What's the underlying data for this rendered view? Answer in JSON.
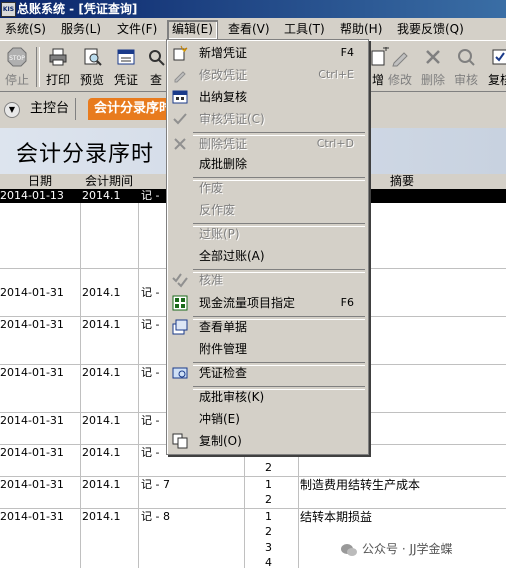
{
  "window": {
    "logo_text": "KIS",
    "title": "总账系统 - [凭证查询]"
  },
  "menubar": [
    {
      "label": "系统(S)"
    },
    {
      "label": "服务(L)"
    },
    {
      "label": "文件(F)"
    },
    {
      "label": "编辑(E)"
    },
    {
      "label": "查看(V)"
    },
    {
      "label": "工具(T)"
    },
    {
      "label": "帮助(H)"
    },
    {
      "label": "我要反馈(Q)"
    }
  ],
  "toolbar": {
    "stop": "停止",
    "print": "打印",
    "preview": "预览",
    "voucher": "凭证",
    "search": "查",
    "add": "增",
    "modify": "修改",
    "delete": "删除",
    "audit": "审核",
    "review": "复核"
  },
  "tabs": {
    "home": "主控台",
    "current": "会计分录序时"
  },
  "page_title": "会计分录序时",
  "grid": {
    "headers": {
      "date": "日期",
      "period": "会计期间",
      "summary": "摘要"
    },
    "rows": [
      {
        "date": "2014-01-13",
        "period": "2014.1",
        "voucher": "记 -",
        "summary": ""
      },
      {
        "date": "2014-01-31",
        "period": "2014.1",
        "voucher": "记 -",
        "summary": ""
      },
      {
        "date": "2014-01-31",
        "period": "2014.1",
        "voucher": "记 -",
        "summary": ""
      },
      {
        "date": "2014-01-31",
        "period": "2014.1",
        "voucher": "记 -",
        "summary": ""
      },
      {
        "date": "2014-01-31",
        "period": "2014.1",
        "voucher": "记 -",
        "summary": ""
      },
      {
        "date": "2014-01-31",
        "period": "2014.1",
        "voucher": "记 -",
        "summary": ""
      },
      {
        "date": "2014-01-31",
        "period": "2014.1",
        "voucher": "记 - 7",
        "summary": "制造费用结转生产成本"
      },
      {
        "date": "2014-01-31",
        "period": "2014.1",
        "voucher": "记 - 8",
        "summary": "结转本期损益"
      }
    ],
    "entry_numbers": [
      "2",
      "1",
      "2",
      "1",
      "2",
      "3",
      "4"
    ]
  },
  "edit_menu": [
    {
      "label": "新增凭证",
      "shortcut": "F4",
      "enabled": true,
      "icon": "new-voucher-icon"
    },
    {
      "label": "修改凭证",
      "shortcut": "Ctrl+E",
      "enabled": false,
      "icon": "edit-voucher-icon"
    },
    {
      "label": "出纳复核",
      "shortcut": "",
      "enabled": true,
      "icon": "cashier-review-icon"
    },
    {
      "label": "审核凭证(C)",
      "shortcut": "",
      "enabled": false,
      "icon": "audit-voucher-icon"
    },
    {
      "label": "删除凭证",
      "shortcut": "Ctrl+D",
      "enabled": false,
      "icon": "delete-icon"
    },
    {
      "label": "成批删除",
      "shortcut": "",
      "enabled": true,
      "icon": ""
    },
    {
      "label": "作废",
      "shortcut": "",
      "enabled": false,
      "icon": ""
    },
    {
      "label": "反作废",
      "shortcut": "",
      "enabled": false,
      "icon": ""
    },
    {
      "label": "过账(P)",
      "shortcut": "",
      "enabled": false,
      "icon": ""
    },
    {
      "label": "全部过账(A)",
      "shortcut": "",
      "enabled": true,
      "icon": ""
    },
    {
      "label": "核准",
      "shortcut": "",
      "enabled": false,
      "icon": "approve-icon"
    },
    {
      "label": "现金流量项目指定",
      "shortcut": "F6",
      "enabled": true,
      "icon": "cashflow-icon"
    },
    {
      "label": "查看单据",
      "shortcut": "",
      "enabled": true,
      "icon": "view-document-icon"
    },
    {
      "label": "附件管理",
      "shortcut": "",
      "enabled": true,
      "icon": ""
    },
    {
      "label": "凭证检查",
      "shortcut": "",
      "enabled": true,
      "icon": "voucher-check-icon"
    },
    {
      "label": "成批审核(K)",
      "shortcut": "",
      "enabled": true,
      "icon": ""
    },
    {
      "label": "冲销(E)",
      "shortcut": "",
      "enabled": true,
      "icon": ""
    },
    {
      "label": "复制(O)",
      "shortcut": "",
      "enabled": true,
      "icon": "copy-icon"
    }
  ],
  "watermark": "公众号 · JJ学金蝶",
  "colors": {
    "title_bar": "#0a246a",
    "tab_active": "#e87b1e",
    "selection": "#000000",
    "menu_bg": "#d4d0c8"
  }
}
